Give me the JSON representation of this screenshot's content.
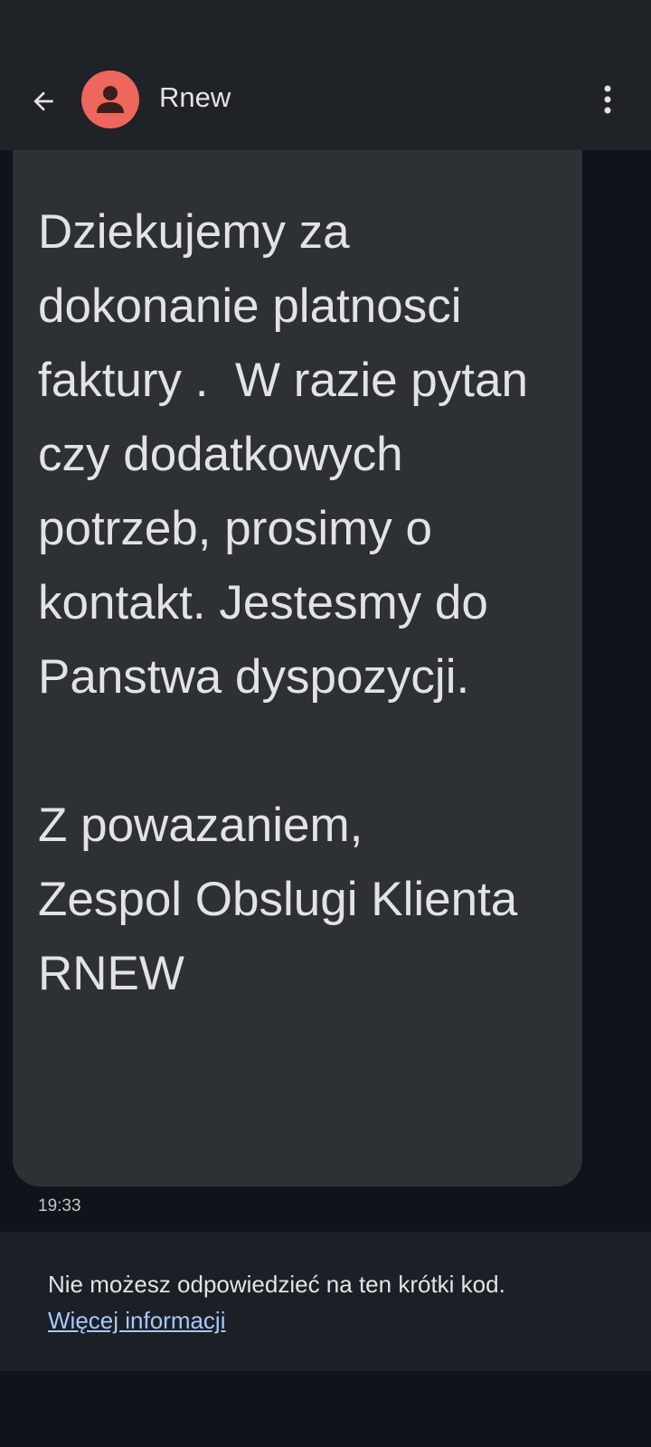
{
  "header": {
    "contact_name": "Rnew",
    "back_icon": "arrow-left-icon",
    "avatar_icon": "person-icon",
    "menu_icon": "more-vert-icon",
    "avatar_color": "#ee675c"
  },
  "message": {
    "body": "Dziekujemy za\ndokonanie platnosci\nfaktury .  W razie pytan\nczy dodatkowych\npotrzeb, prosimy o\nkontakt. Jestesmy do\nPanstwa dyspozycji.\n\nZ powazaniem,\nZespol Obslugi Klienta\nRNEW",
    "time": "19:33"
  },
  "notice": {
    "text": "Nie możesz odpowiedzieć na ten krótki kod.",
    "link_label": "Więcej informacji",
    "link_color": "#a8c7fa"
  }
}
